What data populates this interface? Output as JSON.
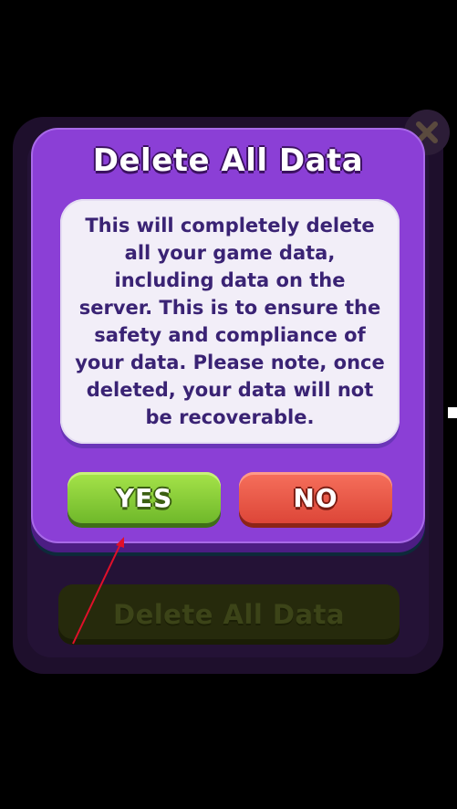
{
  "dialog": {
    "title": "Delete All Data",
    "message": "This will completely delete all your game data, including data on the server. This is to ensure the safety and compliance of your data. Please note, once deleted, your data will not be recoverable.",
    "yes_label": "YES",
    "no_label": "NO"
  },
  "background": {
    "delete_button_label": "Delete All Data"
  },
  "icons": {
    "close": "close-icon",
    "annotation": "red-arrow"
  },
  "colors": {
    "dialog": "#8b3fd6",
    "yes": "#8bcf38",
    "no": "#e9564a",
    "text": "#3a2374",
    "annotation": "#e0102a"
  }
}
